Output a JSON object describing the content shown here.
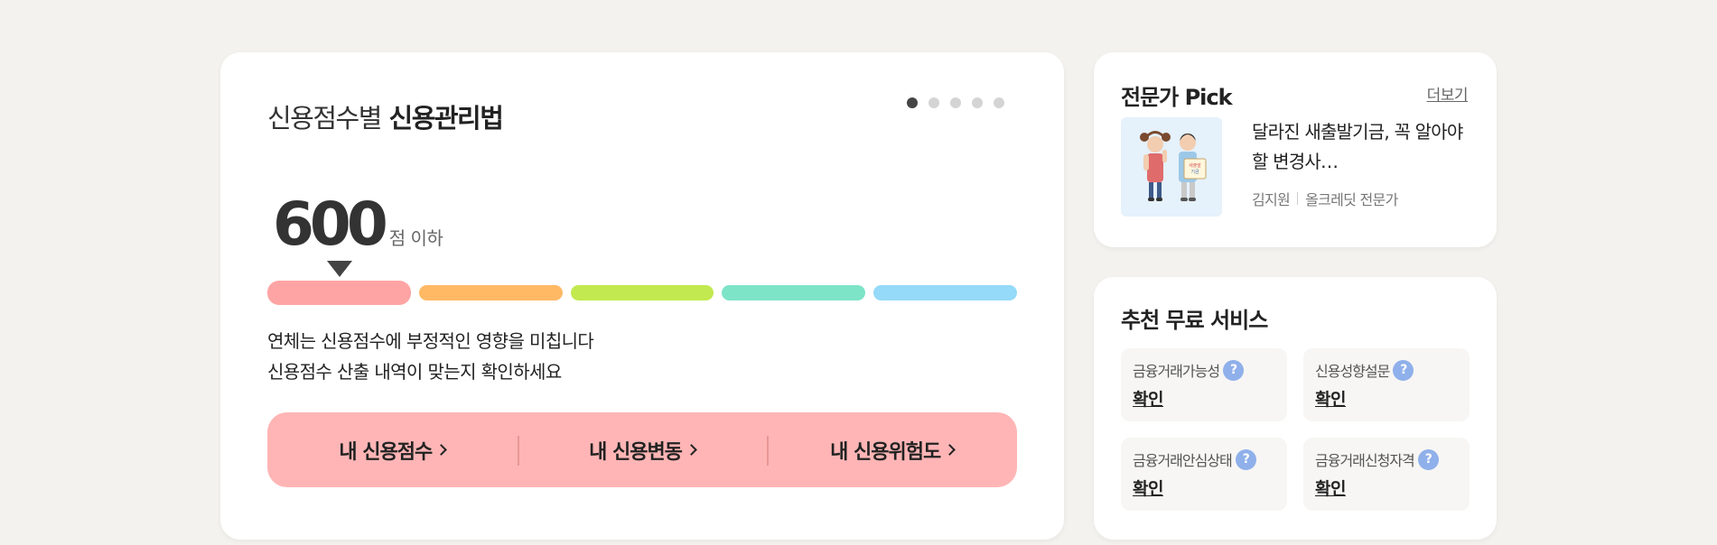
{
  "main": {
    "title_light": "신용점수별",
    "title_bold": "신용관리법",
    "score": "600",
    "score_unit": "점 이하",
    "desc_line1": "연체는 신용점수에 부정적인 영향을 미칩니다",
    "desc_line2": "신용점수 산출 내역이 맞는지 확인하세요",
    "carousel_page": 1,
    "carousel_total": 5,
    "segments": [
      "#ffa4a4",
      "#ffb965",
      "#c2e94f",
      "#7de4c8",
      "#95daf8"
    ],
    "active_segment": 0,
    "actions": [
      {
        "label": "내 신용점수"
      },
      {
        "label": "내 신용변동"
      },
      {
        "label": "내 신용위험도"
      }
    ]
  },
  "expert": {
    "heading": "전문가 Pick",
    "more": "더보기",
    "article_title": "달라진 새출발기금, 꼭 알아야 할 변경사…",
    "author": "김지원",
    "author_role": "올크레딧 전문가"
  },
  "services": {
    "heading": "추천 무료 서비스",
    "items": [
      {
        "label": "금융거래가능성",
        "value": "확인"
      },
      {
        "label": "신용성향설문",
        "value": "확인"
      },
      {
        "label": "금융거래안심상태",
        "value": "확인"
      },
      {
        "label": "금융거래신청자격",
        "value": "확인"
      }
    ]
  },
  "colors": {
    "background": "#f4f2ee",
    "action_bar": "#ffb5b5",
    "help_icon": "#8fb0ea"
  }
}
